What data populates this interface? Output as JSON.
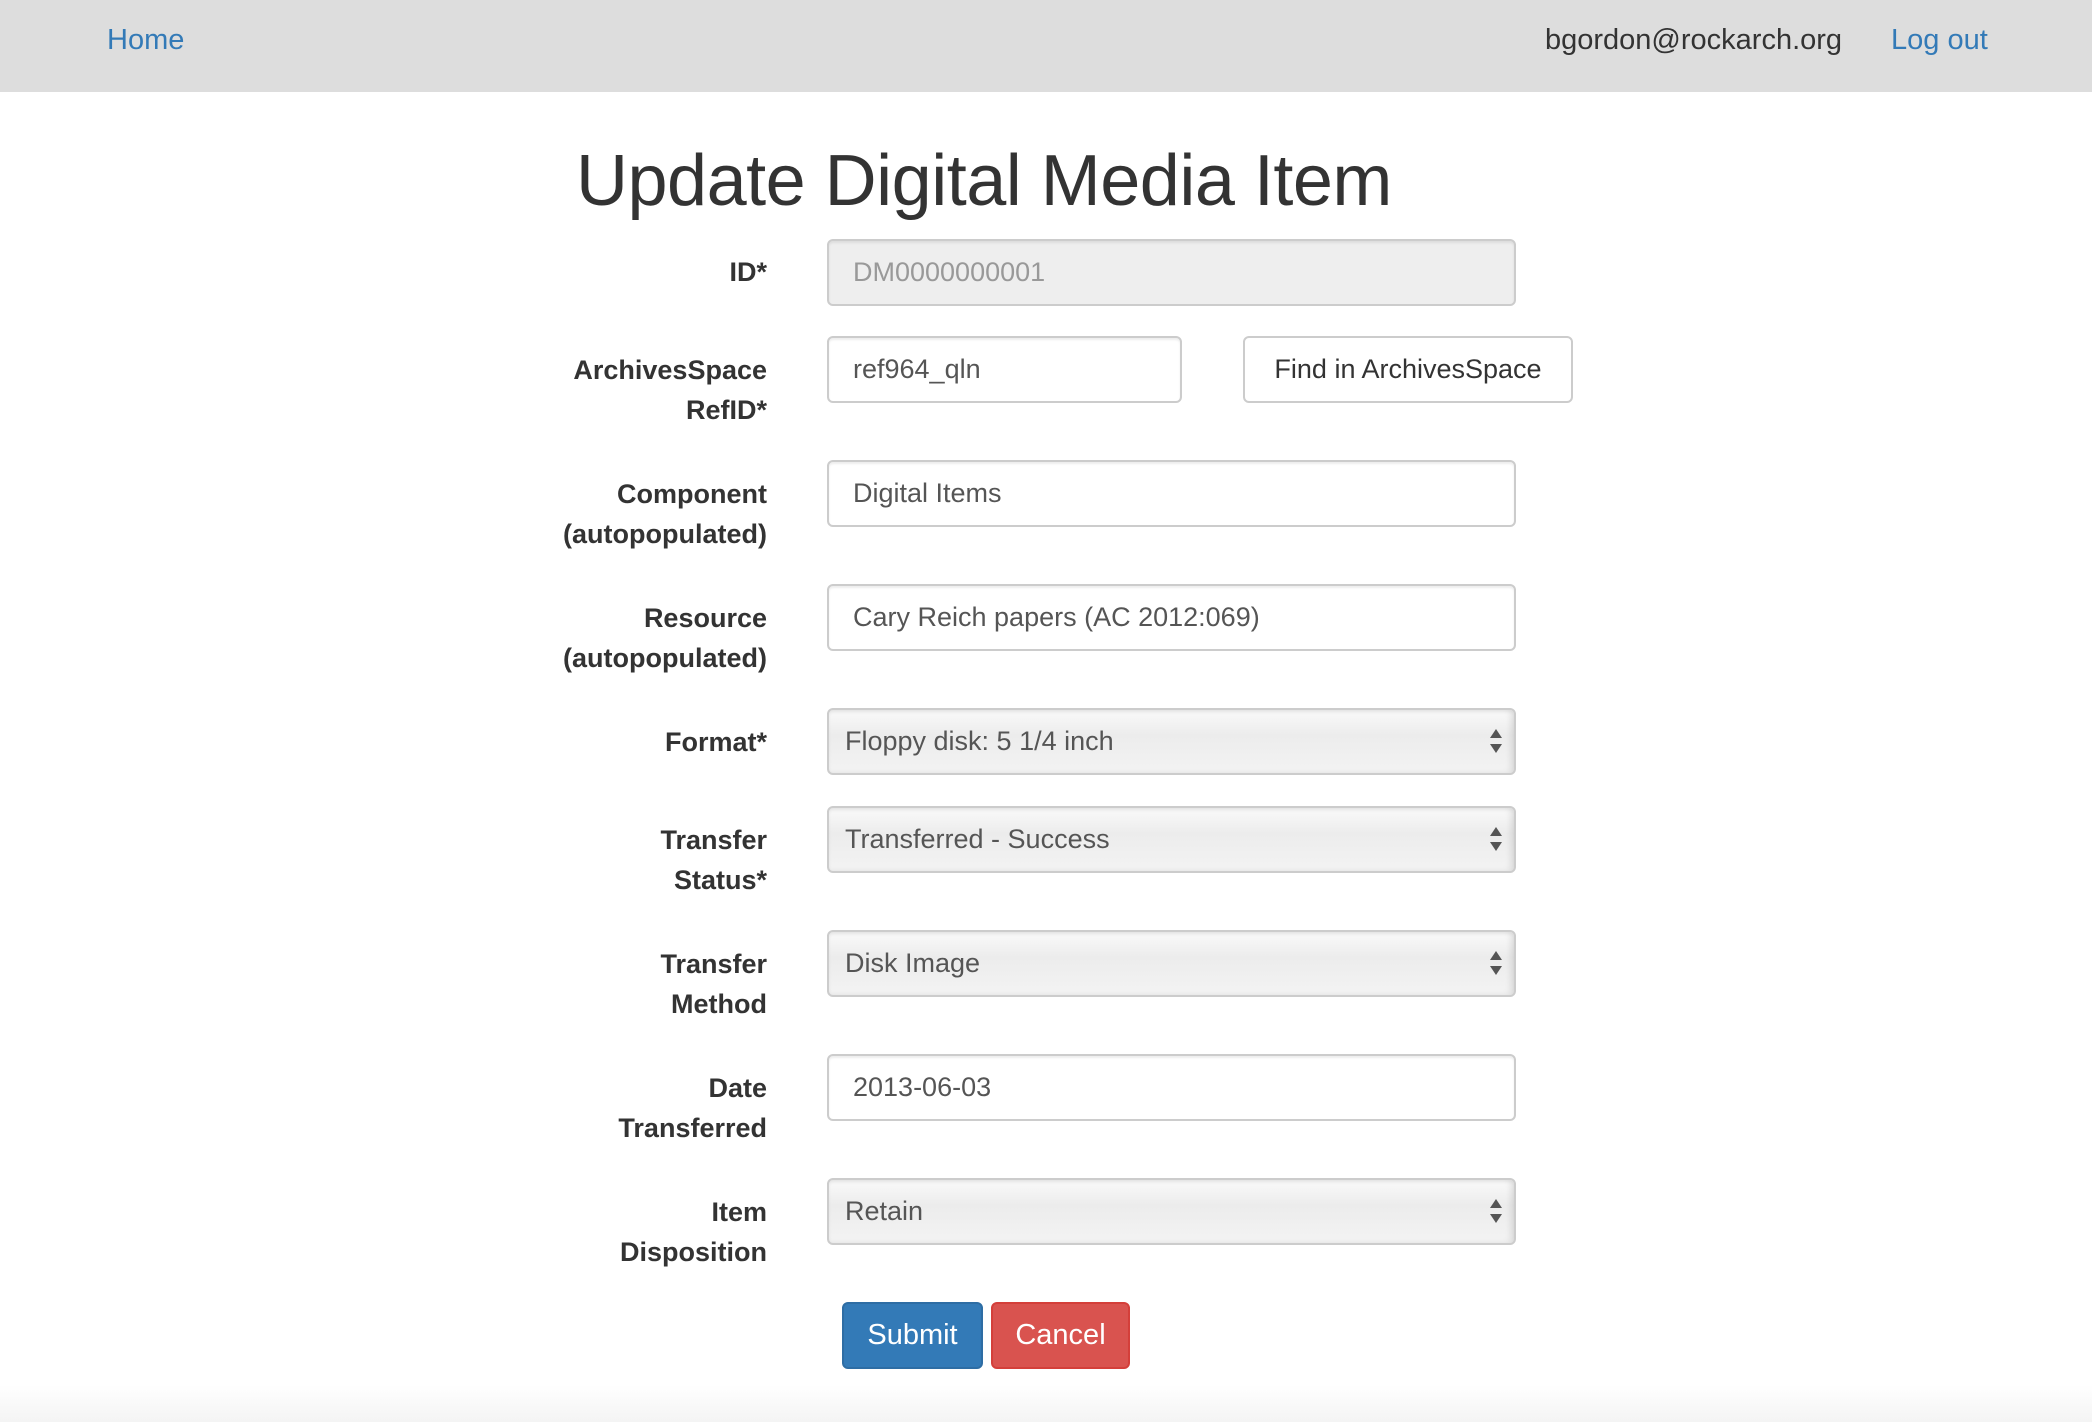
{
  "nav": {
    "home": "Home",
    "user_email": "bgordon@rockarch.org",
    "logout": "Log out"
  },
  "page_title": "Update Digital Media Item",
  "form": {
    "id": {
      "label": "ID*",
      "value": "DM0000000001"
    },
    "refid": {
      "label_line1": "ArchivesSpace",
      "label_line2": "RefID*",
      "value": "ref964_qln",
      "find_button": "Find in ArchivesSpace"
    },
    "component": {
      "label_line1": "Component",
      "label_line2": "(autopopulated)",
      "value": "Digital Items"
    },
    "resource": {
      "label_line1": "Resource",
      "label_line2": "(autopopulated)",
      "value": "Cary Reich papers (AC 2012:069)"
    },
    "format": {
      "label": "Format*",
      "selected": "Floppy disk: 5 1/4 inch"
    },
    "transfer_status": {
      "label_line1": "Transfer",
      "label_line2": "Status*",
      "selected": "Transferred - Success"
    },
    "transfer_method": {
      "label_line1": "Transfer",
      "label_line2": "Method",
      "selected": "Disk Image"
    },
    "date_transferred": {
      "label_line1": "Date",
      "label_line2": "Transferred",
      "value": "2013-06-03"
    },
    "item_disposition": {
      "label_line1": "Item",
      "label_line2": "Disposition",
      "selected": "Retain"
    }
  },
  "buttons": {
    "submit": "Submit",
    "cancel": "Cancel"
  },
  "colors": {
    "link": "#337ab7",
    "primary": "#337ab7",
    "danger": "#d9534f",
    "navbar": "#dddddd"
  }
}
